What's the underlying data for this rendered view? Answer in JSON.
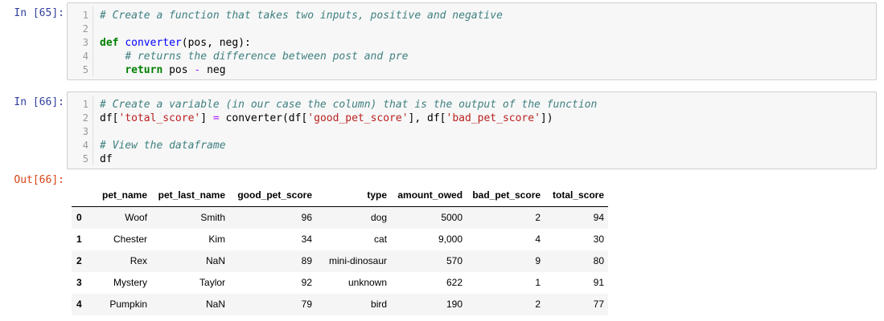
{
  "cells": [
    {
      "prompt": "In [65]:",
      "lines": [
        {
          "num": "1",
          "tokens": [
            {
              "t": "# Create a function that takes two inputs, positive and negative",
              "c": "cm"
            }
          ]
        },
        {
          "num": "2",
          "tokens": []
        },
        {
          "num": "3",
          "tokens": [
            {
              "t": "def",
              "c": "kw"
            },
            {
              "t": " ",
              "c": ""
            },
            {
              "t": "converter",
              "c": "fn"
            },
            {
              "t": "(pos, neg):",
              "c": ""
            }
          ]
        },
        {
          "num": "4",
          "tokens": [
            {
              "t": "    ",
              "c": ""
            },
            {
              "t": "# returns the difference between post and pre",
              "c": "cm"
            }
          ]
        },
        {
          "num": "5",
          "tokens": [
            {
              "t": "    ",
              "c": ""
            },
            {
              "t": "return",
              "c": "kw"
            },
            {
              "t": " pos ",
              "c": ""
            },
            {
              "t": "-",
              "c": "op"
            },
            {
              "t": " neg",
              "c": ""
            }
          ]
        }
      ]
    },
    {
      "prompt": "In [66]:",
      "lines": [
        {
          "num": "1",
          "tokens": [
            {
              "t": "# Create a variable (in our case the column) that is the output of the function",
              "c": "cm"
            }
          ]
        },
        {
          "num": "2",
          "tokens": [
            {
              "t": "df[",
              "c": ""
            },
            {
              "t": "'total_score'",
              "c": "st"
            },
            {
              "t": "] ",
              "c": ""
            },
            {
              "t": "=",
              "c": "op"
            },
            {
              "t": " converter(df[",
              "c": ""
            },
            {
              "t": "'good_pet_score'",
              "c": "st"
            },
            {
              "t": "], df[",
              "c": ""
            },
            {
              "t": "'bad_pet_score'",
              "c": "st"
            },
            {
              "t": "])",
              "c": ""
            }
          ]
        },
        {
          "num": "3",
          "tokens": []
        },
        {
          "num": "4",
          "tokens": [
            {
              "t": "# View the dataframe",
              "c": "cm"
            }
          ]
        },
        {
          "num": "5",
          "tokens": [
            {
              "t": "df",
              "c": ""
            }
          ]
        }
      ]
    }
  ],
  "output": {
    "prompt": "Out[66]:",
    "columns": [
      "",
      "pet_name",
      "pet_last_name",
      "good_pet_score",
      "type",
      "amount_owed",
      "bad_pet_score",
      "total_score"
    ],
    "rows": [
      [
        "0",
        "Woof",
        "Smith",
        "96",
        "dog",
        "5000",
        "2",
        "94"
      ],
      [
        "1",
        "Chester",
        "Kim",
        "34",
        "cat",
        "9,000",
        "4",
        "30"
      ],
      [
        "2",
        "Rex",
        "NaN",
        "89",
        "mini-dinosaur",
        "570",
        "9",
        "80"
      ],
      [
        "3",
        "Mystery",
        "Taylor",
        "92",
        "unknown",
        "622",
        "1",
        "91"
      ],
      [
        "4",
        "Pumpkin",
        "NaN",
        "79",
        "bird",
        "190",
        "2",
        "77"
      ]
    ]
  },
  "colors": {
    "in_prompt": "#303f9f",
    "out_prompt": "#d84315",
    "comment": "#408080",
    "keyword": "#008000",
    "string": "#ba2121"
  }
}
